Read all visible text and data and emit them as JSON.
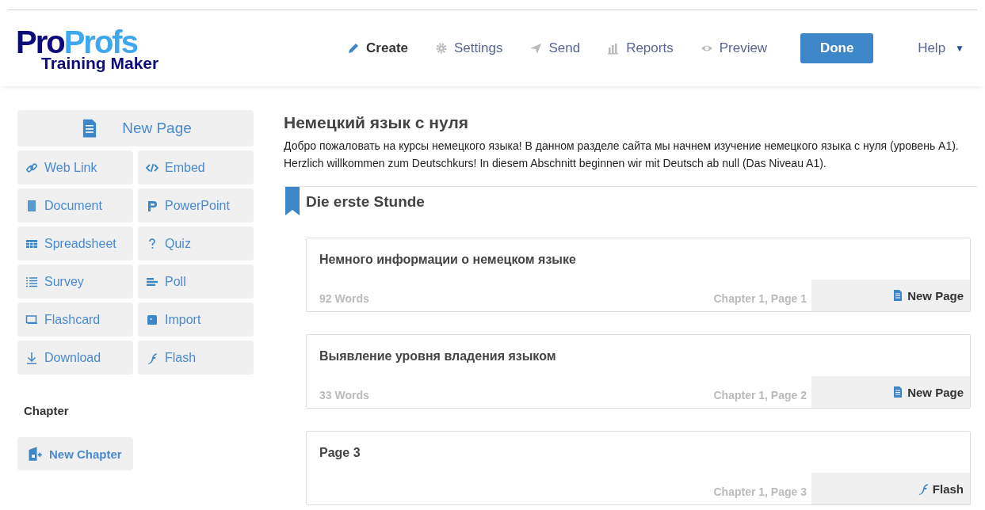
{
  "logo": {
    "brand_dark": "Pro",
    "brand_light": "Profs",
    "subtitle": "Training Maker"
  },
  "nav": [
    {
      "kind": "create",
      "label": "Create",
      "selected": true
    },
    {
      "kind": "settings",
      "label": "Settings",
      "selected": false
    },
    {
      "kind": "send",
      "label": "Send",
      "selected": false
    },
    {
      "kind": "reports",
      "label": "Reports",
      "selected": false
    },
    {
      "kind": "preview",
      "label": "Preview",
      "selected": false
    }
  ],
  "done_button": "Done",
  "help": {
    "label": "Help",
    "caret": "▼"
  },
  "sidebar": {
    "new_page": "New Page",
    "tiles": [
      {
        "kind": "link",
        "label": "Web Link"
      },
      {
        "kind": "embed",
        "label": "Embed"
      },
      {
        "kind": "document",
        "label": "Document"
      },
      {
        "kind": "powerpoint",
        "label": "PowerPoint"
      },
      {
        "kind": "spreadsheet",
        "label": "Spreadsheet"
      },
      {
        "kind": "quiz",
        "label": "Quiz"
      },
      {
        "kind": "survey",
        "label": "Survey"
      },
      {
        "kind": "poll",
        "label": "Poll"
      },
      {
        "kind": "flashcard",
        "label": "Flashcard"
      },
      {
        "kind": "import",
        "label": "Import"
      },
      {
        "kind": "download",
        "label": "Download"
      },
      {
        "kind": "flash",
        "label": "Flash"
      }
    ],
    "chapter_heading": "Chapter",
    "new_chapter": "New Chapter"
  },
  "course": {
    "title": "Немецкий язык с нуля",
    "description": "Добро пожаловать на курсы немецкого языка! В данном разделе сайта мы начнем изучение немецкого языка с нуля (уровень А1). Herzlich willkommen zum Deutschkurs! In diesem Abschnitt beginnen wir mit Deutsch ab null (Das Niveau A1)."
  },
  "chapter": {
    "title": "Die erste Stunde",
    "pages": [
      {
        "title": "Немного информации о немецком языке",
        "words": "92 Words",
        "location": "Chapter 1, Page 1",
        "kind": "page",
        "type_label": "New Page"
      },
      {
        "title": "Выявление уровня владения языком",
        "words": "33 Words",
        "location": "Chapter 1, Page 2",
        "kind": "page",
        "type_label": "New Page"
      },
      {
        "title": "Page 3",
        "location": "Chapter 1, Page 3",
        "kind": "flash",
        "type_label": "Flash"
      }
    ]
  }
}
